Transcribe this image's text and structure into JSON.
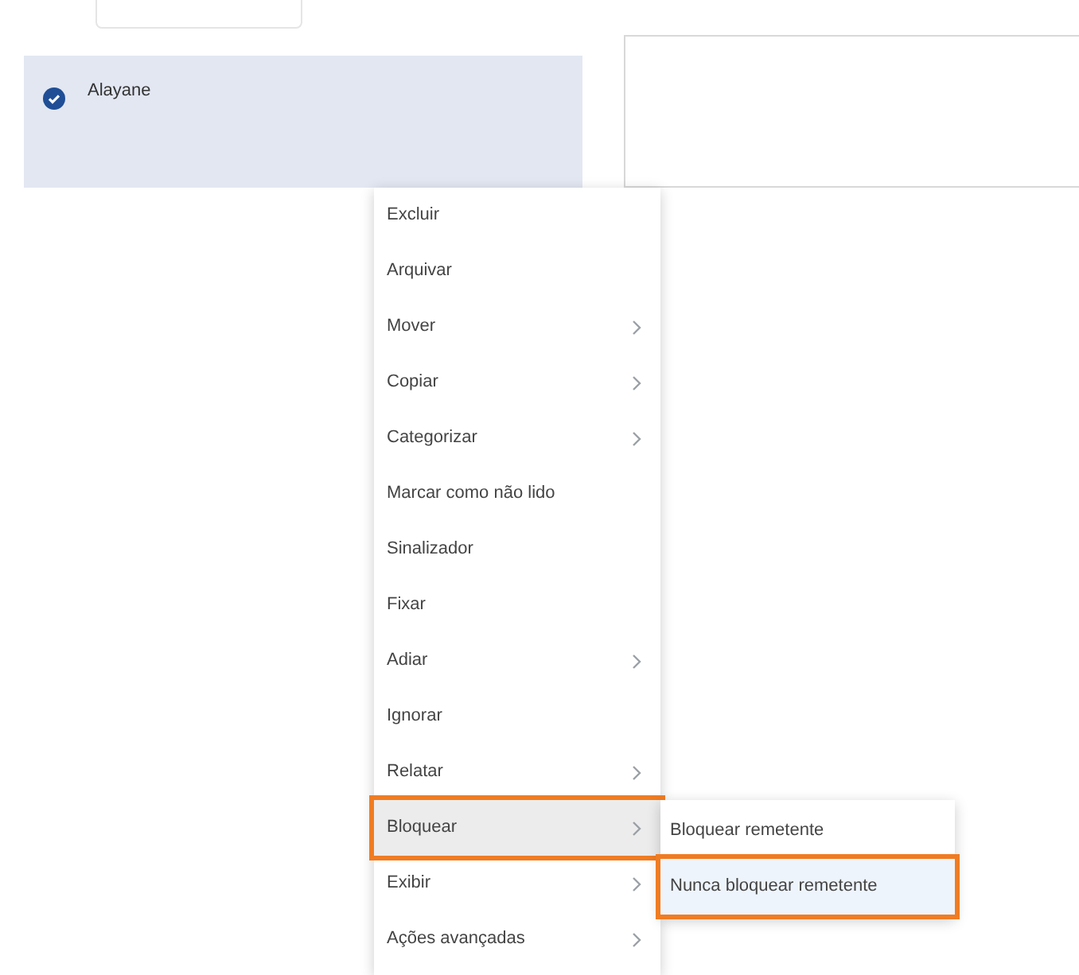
{
  "message_list": {
    "items": [
      {
        "sender": "Alayane",
        "selected": true
      }
    ]
  },
  "context_menu": {
    "items": [
      {
        "label": "Excluir",
        "submenu": false,
        "selected": false,
        "highlighted": false
      },
      {
        "label": "Arquivar",
        "submenu": false,
        "selected": false,
        "highlighted": false
      },
      {
        "label": "Mover",
        "submenu": true,
        "selected": false,
        "highlighted": false
      },
      {
        "label": "Copiar",
        "submenu": true,
        "selected": false,
        "highlighted": false
      },
      {
        "label": "Categorizar",
        "submenu": true,
        "selected": false,
        "highlighted": false
      },
      {
        "label": "Marcar como não lido",
        "submenu": false,
        "selected": false,
        "highlighted": false
      },
      {
        "label": "Sinalizador",
        "submenu": false,
        "selected": false,
        "highlighted": false
      },
      {
        "label": "Fixar",
        "submenu": false,
        "selected": false,
        "highlighted": false
      },
      {
        "label": "Adiar",
        "submenu": true,
        "selected": false,
        "highlighted": false
      },
      {
        "label": "Ignorar",
        "submenu": false,
        "selected": false,
        "highlighted": false
      },
      {
        "label": "Relatar",
        "submenu": true,
        "selected": false,
        "highlighted": false
      },
      {
        "label": "Bloquear",
        "submenu": true,
        "selected": true,
        "highlighted": true
      },
      {
        "label": "Exibir",
        "submenu": true,
        "selected": false,
        "highlighted": false
      },
      {
        "label": "Ações avançadas",
        "submenu": true,
        "selected": false,
        "highlighted": false
      }
    ]
  },
  "submenu": {
    "items": [
      {
        "label": "Bloquear remetente",
        "selected": false,
        "highlighted": false
      },
      {
        "label": "Nunca bloquear remetente",
        "selected": true,
        "highlighted": true
      }
    ]
  }
}
